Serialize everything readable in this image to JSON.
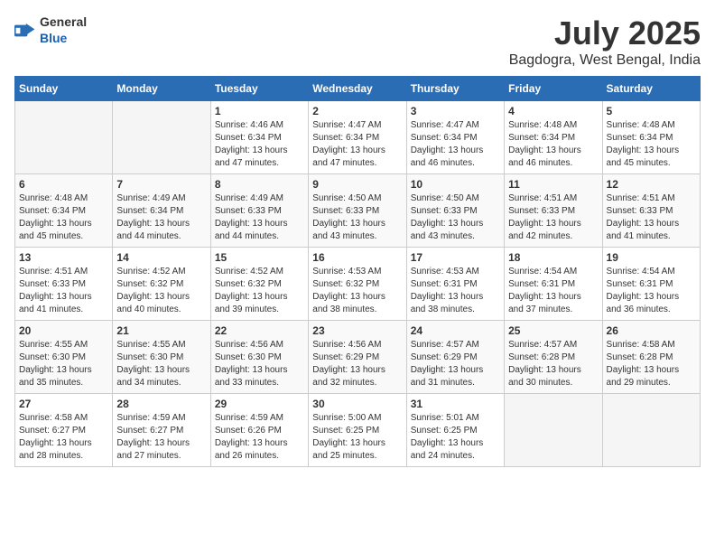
{
  "header": {
    "logo": {
      "general": "General",
      "blue": "Blue"
    },
    "title": "July 2025",
    "subtitle": "Bagdogra, West Bengal, India"
  },
  "days_of_week": [
    "Sunday",
    "Monday",
    "Tuesday",
    "Wednesday",
    "Thursday",
    "Friday",
    "Saturday"
  ],
  "weeks": [
    [
      {
        "day": "",
        "sunrise": "",
        "sunset": "",
        "daylight": "",
        "empty": true
      },
      {
        "day": "",
        "sunrise": "",
        "sunset": "",
        "daylight": "",
        "empty": true
      },
      {
        "day": "1",
        "sunrise": "Sunrise: 4:46 AM",
        "sunset": "Sunset: 6:34 PM",
        "daylight": "Daylight: 13 hours and 47 minutes."
      },
      {
        "day": "2",
        "sunrise": "Sunrise: 4:47 AM",
        "sunset": "Sunset: 6:34 PM",
        "daylight": "Daylight: 13 hours and 47 minutes."
      },
      {
        "day": "3",
        "sunrise": "Sunrise: 4:47 AM",
        "sunset": "Sunset: 6:34 PM",
        "daylight": "Daylight: 13 hours and 46 minutes."
      },
      {
        "day": "4",
        "sunrise": "Sunrise: 4:48 AM",
        "sunset": "Sunset: 6:34 PM",
        "daylight": "Daylight: 13 hours and 46 minutes."
      },
      {
        "day": "5",
        "sunrise": "Sunrise: 4:48 AM",
        "sunset": "Sunset: 6:34 PM",
        "daylight": "Daylight: 13 hours and 45 minutes."
      }
    ],
    [
      {
        "day": "6",
        "sunrise": "Sunrise: 4:48 AM",
        "sunset": "Sunset: 6:34 PM",
        "daylight": "Daylight: 13 hours and 45 minutes."
      },
      {
        "day": "7",
        "sunrise": "Sunrise: 4:49 AM",
        "sunset": "Sunset: 6:34 PM",
        "daylight": "Daylight: 13 hours and 44 minutes."
      },
      {
        "day": "8",
        "sunrise": "Sunrise: 4:49 AM",
        "sunset": "Sunset: 6:33 PM",
        "daylight": "Daylight: 13 hours and 44 minutes."
      },
      {
        "day": "9",
        "sunrise": "Sunrise: 4:50 AM",
        "sunset": "Sunset: 6:33 PM",
        "daylight": "Daylight: 13 hours and 43 minutes."
      },
      {
        "day": "10",
        "sunrise": "Sunrise: 4:50 AM",
        "sunset": "Sunset: 6:33 PM",
        "daylight": "Daylight: 13 hours and 43 minutes."
      },
      {
        "day": "11",
        "sunrise": "Sunrise: 4:51 AM",
        "sunset": "Sunset: 6:33 PM",
        "daylight": "Daylight: 13 hours and 42 minutes."
      },
      {
        "day": "12",
        "sunrise": "Sunrise: 4:51 AM",
        "sunset": "Sunset: 6:33 PM",
        "daylight": "Daylight: 13 hours and 41 minutes."
      }
    ],
    [
      {
        "day": "13",
        "sunrise": "Sunrise: 4:51 AM",
        "sunset": "Sunset: 6:33 PM",
        "daylight": "Daylight: 13 hours and 41 minutes."
      },
      {
        "day": "14",
        "sunrise": "Sunrise: 4:52 AM",
        "sunset": "Sunset: 6:32 PM",
        "daylight": "Daylight: 13 hours and 40 minutes."
      },
      {
        "day": "15",
        "sunrise": "Sunrise: 4:52 AM",
        "sunset": "Sunset: 6:32 PM",
        "daylight": "Daylight: 13 hours and 39 minutes."
      },
      {
        "day": "16",
        "sunrise": "Sunrise: 4:53 AM",
        "sunset": "Sunset: 6:32 PM",
        "daylight": "Daylight: 13 hours and 38 minutes."
      },
      {
        "day": "17",
        "sunrise": "Sunrise: 4:53 AM",
        "sunset": "Sunset: 6:31 PM",
        "daylight": "Daylight: 13 hours and 38 minutes."
      },
      {
        "day": "18",
        "sunrise": "Sunrise: 4:54 AM",
        "sunset": "Sunset: 6:31 PM",
        "daylight": "Daylight: 13 hours and 37 minutes."
      },
      {
        "day": "19",
        "sunrise": "Sunrise: 4:54 AM",
        "sunset": "Sunset: 6:31 PM",
        "daylight": "Daylight: 13 hours and 36 minutes."
      }
    ],
    [
      {
        "day": "20",
        "sunrise": "Sunrise: 4:55 AM",
        "sunset": "Sunset: 6:30 PM",
        "daylight": "Daylight: 13 hours and 35 minutes."
      },
      {
        "day": "21",
        "sunrise": "Sunrise: 4:55 AM",
        "sunset": "Sunset: 6:30 PM",
        "daylight": "Daylight: 13 hours and 34 minutes."
      },
      {
        "day": "22",
        "sunrise": "Sunrise: 4:56 AM",
        "sunset": "Sunset: 6:30 PM",
        "daylight": "Daylight: 13 hours and 33 minutes."
      },
      {
        "day": "23",
        "sunrise": "Sunrise: 4:56 AM",
        "sunset": "Sunset: 6:29 PM",
        "daylight": "Daylight: 13 hours and 32 minutes."
      },
      {
        "day": "24",
        "sunrise": "Sunrise: 4:57 AM",
        "sunset": "Sunset: 6:29 PM",
        "daylight": "Daylight: 13 hours and 31 minutes."
      },
      {
        "day": "25",
        "sunrise": "Sunrise: 4:57 AM",
        "sunset": "Sunset: 6:28 PM",
        "daylight": "Daylight: 13 hours and 30 minutes."
      },
      {
        "day": "26",
        "sunrise": "Sunrise: 4:58 AM",
        "sunset": "Sunset: 6:28 PM",
        "daylight": "Daylight: 13 hours and 29 minutes."
      }
    ],
    [
      {
        "day": "27",
        "sunrise": "Sunrise: 4:58 AM",
        "sunset": "Sunset: 6:27 PM",
        "daylight": "Daylight: 13 hours and 28 minutes."
      },
      {
        "day": "28",
        "sunrise": "Sunrise: 4:59 AM",
        "sunset": "Sunset: 6:27 PM",
        "daylight": "Daylight: 13 hours and 27 minutes."
      },
      {
        "day": "29",
        "sunrise": "Sunrise: 4:59 AM",
        "sunset": "Sunset: 6:26 PM",
        "daylight": "Daylight: 13 hours and 26 minutes."
      },
      {
        "day": "30",
        "sunrise": "Sunrise: 5:00 AM",
        "sunset": "Sunset: 6:25 PM",
        "daylight": "Daylight: 13 hours and 25 minutes."
      },
      {
        "day": "31",
        "sunrise": "Sunrise: 5:01 AM",
        "sunset": "Sunset: 6:25 PM",
        "daylight": "Daylight: 13 hours and 24 minutes."
      },
      {
        "day": "",
        "sunrise": "",
        "sunset": "",
        "daylight": "",
        "empty": true
      },
      {
        "day": "",
        "sunrise": "",
        "sunset": "",
        "daylight": "",
        "empty": true
      }
    ]
  ]
}
